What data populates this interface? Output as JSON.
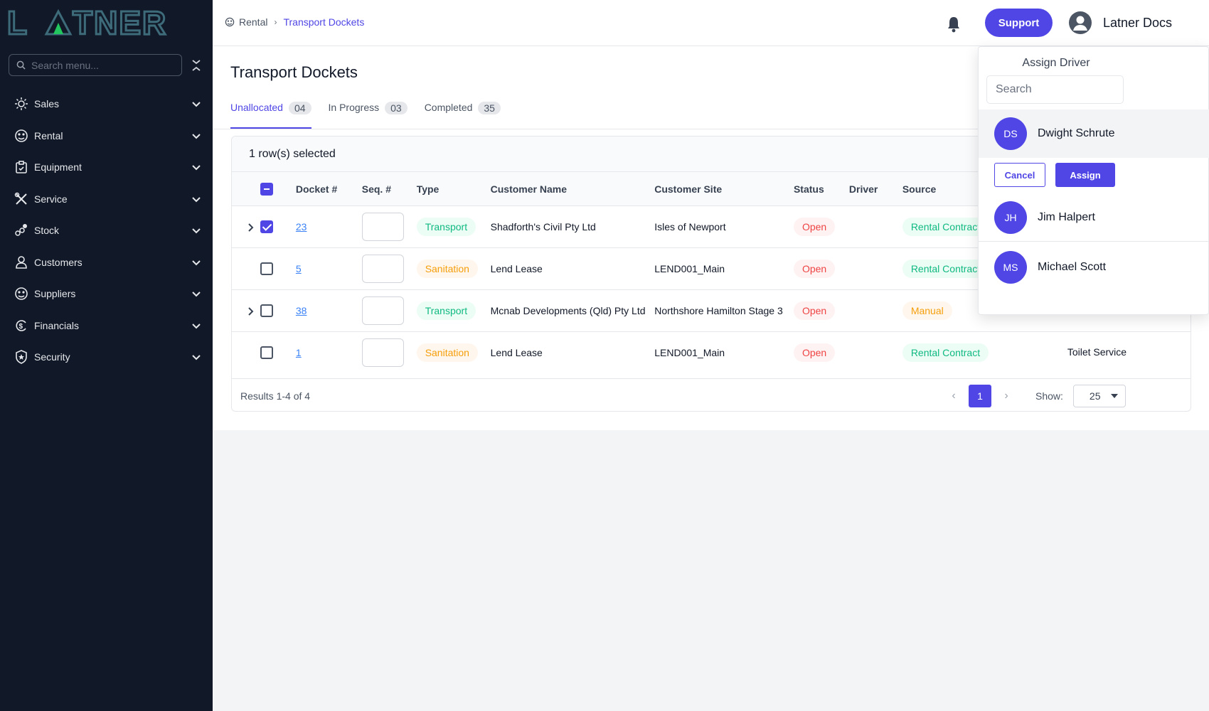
{
  "brand": {
    "logo_text": "LATNER"
  },
  "sidebar": {
    "search_placeholder": "Search menu...",
    "items": [
      {
        "label": "Sales",
        "icon": "sales-icon"
      },
      {
        "label": "Rental",
        "icon": "rental-icon"
      },
      {
        "label": "Equipment",
        "icon": "equipment-icon"
      },
      {
        "label": "Service",
        "icon": "service-icon"
      },
      {
        "label": "Stock",
        "icon": "stock-icon"
      },
      {
        "label": "Customers",
        "icon": "customers-icon"
      },
      {
        "label": "Suppliers",
        "icon": "suppliers-icon"
      },
      {
        "label": "Financials",
        "icon": "financials-icon"
      },
      {
        "label": "Security",
        "icon": "security-icon"
      }
    ]
  },
  "header": {
    "breadcrumb": [
      "Rental",
      "Transport Dockets"
    ],
    "support_label": "Support",
    "user_name": "Latner Docs"
  },
  "main": {
    "title": "Transport Dockets",
    "tabs": [
      {
        "label": "Unallocated",
        "count": "04"
      },
      {
        "label": "In Progress",
        "count": "03"
      },
      {
        "label": "Completed",
        "count": "35"
      }
    ],
    "selection_text": "1 row(s) selected",
    "columns": [
      "Docket #",
      "Seq. #",
      "Type",
      "Customer Name",
      "Customer Site",
      "Status",
      "Driver",
      "Source"
    ],
    "rows": [
      {
        "docket": "23",
        "type": "Transport",
        "customer": "Shadforth's Civil Pty Ltd",
        "site": "Isles of Newport",
        "status": "Open",
        "source": "Rental Contract",
        "extra": ""
      },
      {
        "docket": "5",
        "type": "Sanitation",
        "customer": "Lend Lease",
        "site": "LEND001_Main",
        "status": "Open",
        "source": "Rental Contract",
        "extra": ""
      },
      {
        "docket": "38",
        "type": "Transport",
        "customer": "Mcnab Developments (Qld) Pty Ltd",
        "site": "Northshore Hamilton Stage 3",
        "status": "Open",
        "source": "Manual",
        "extra": ""
      },
      {
        "docket": "1",
        "type": "Sanitation",
        "customer": "Lend Lease",
        "site": "LEND001_Main",
        "status": "Open",
        "source": "Rental Contract",
        "extra": "Toilet Service"
      }
    ],
    "results_text": "Results 1-4 of 4",
    "page": "1",
    "show_label": "Show:",
    "page_size": "25"
  },
  "assign": {
    "title": "Assign Driver",
    "search_placeholder": "Search",
    "cancel_label": "Cancel",
    "assign_label": "Assign",
    "drivers": [
      {
        "initials": "DS",
        "name": "Dwight Schrute"
      },
      {
        "initials": "JH",
        "name": "Jim Halpert"
      },
      {
        "initials": "MS",
        "name": "Michael Scott"
      }
    ]
  },
  "colors": {
    "accent": "#4f46e5",
    "sidebar": "#111827",
    "success": "#10b981",
    "warning": "#f59e0b",
    "danger": "#ef4444"
  }
}
